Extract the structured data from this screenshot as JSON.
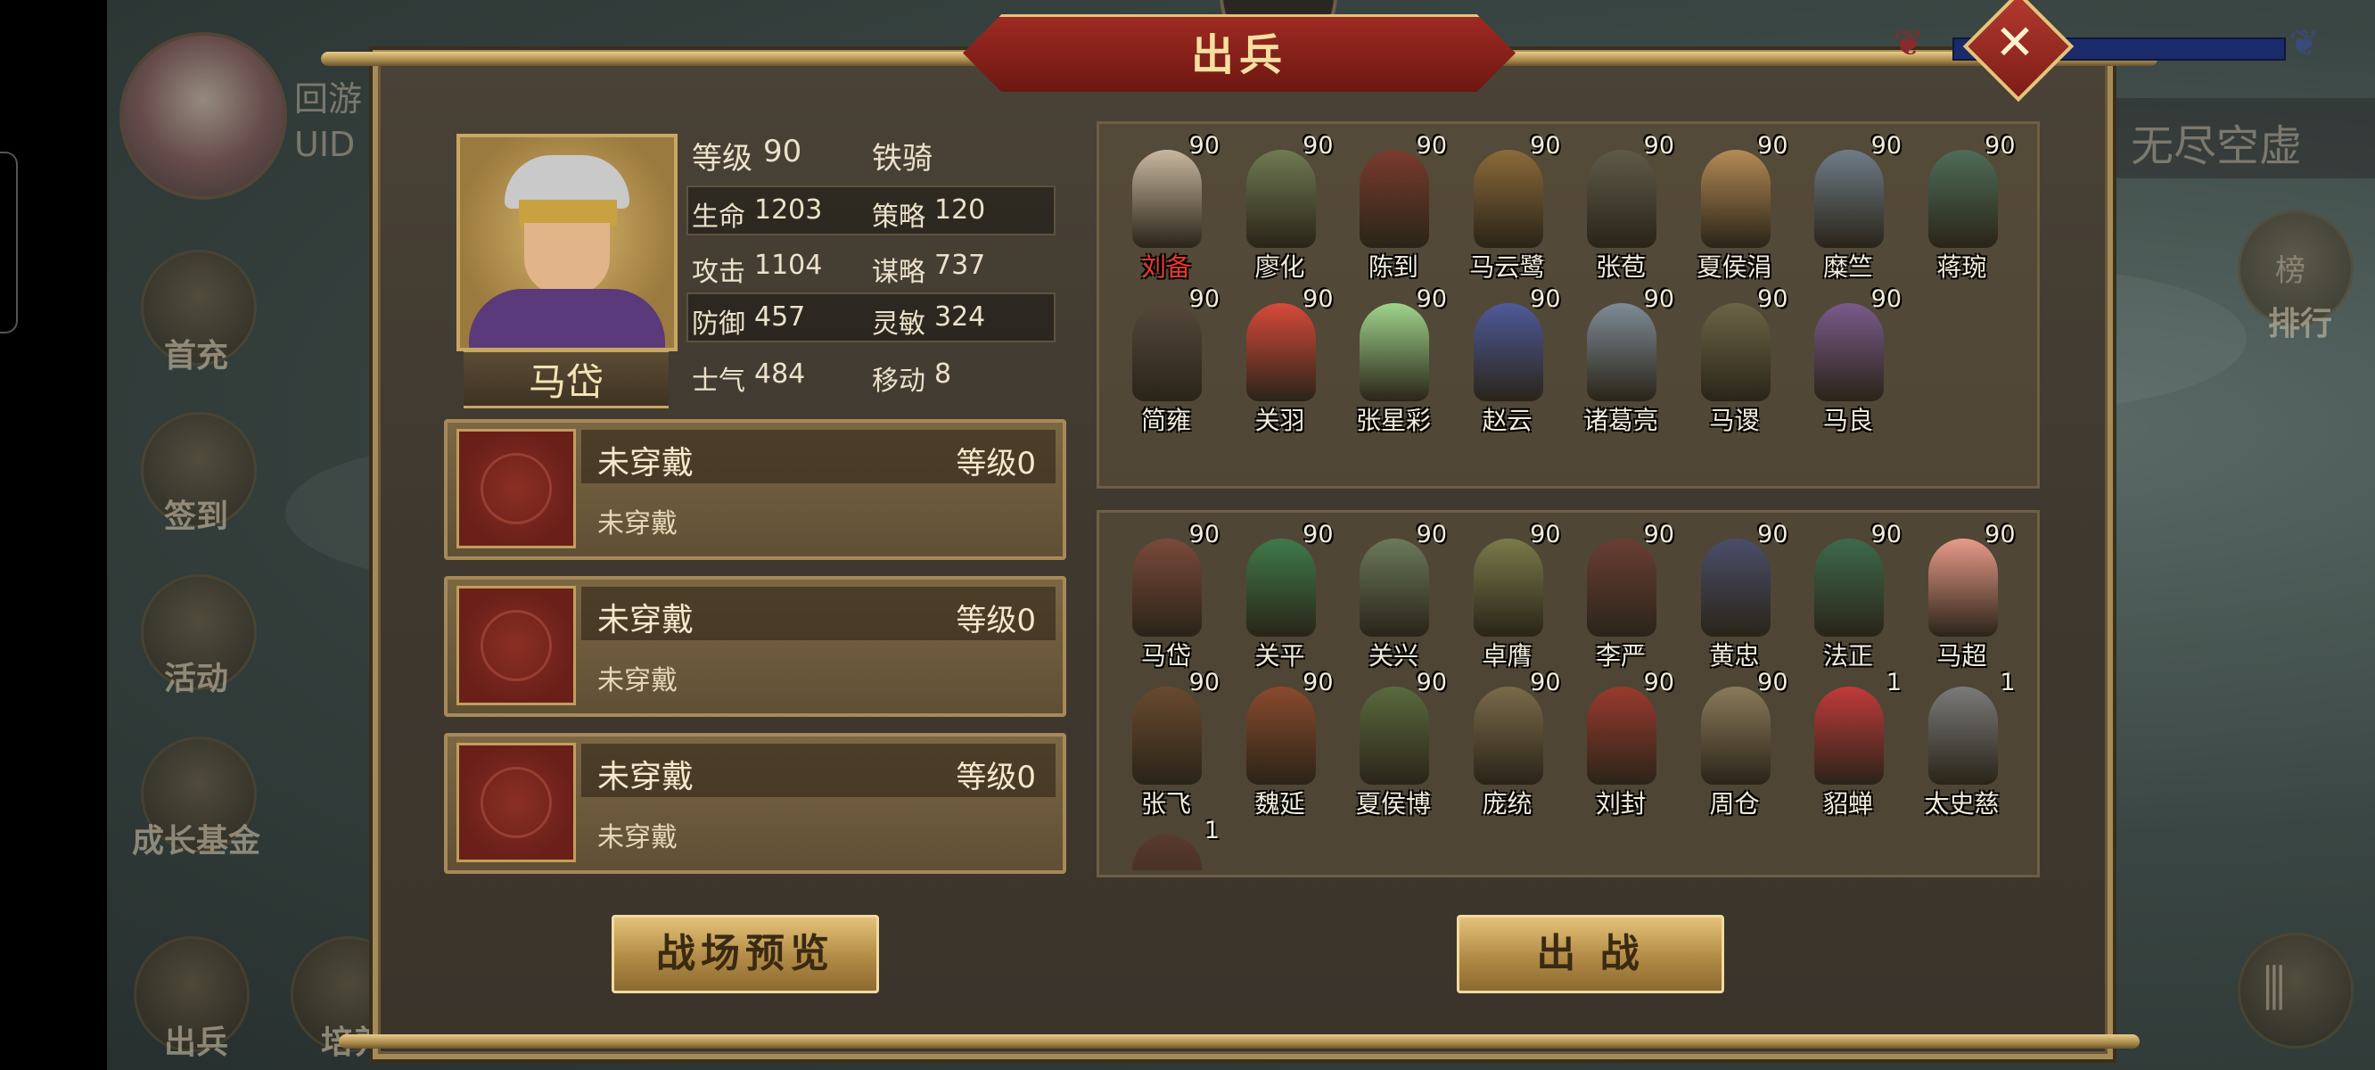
{
  "background": {
    "avatar_text_1": "回游",
    "avatar_text_2": "UID",
    "server_name": "无尽空虚",
    "ranking_label": "排行",
    "ranking_icon_text": "榜",
    "side_menu": [
      "首充",
      "签到",
      "活动",
      "成长基金"
    ],
    "bottom_menu": [
      "出兵",
      "培养"
    ]
  },
  "dialog": {
    "title": "出兵",
    "close_icon": "close-icon"
  },
  "general": {
    "name": "马岱",
    "level_label": "等级",
    "level_value": "90",
    "troop_type": "铁骑",
    "stats": [
      {
        "label": "生命",
        "value": "1203",
        "label2": "策略",
        "value2": "120"
      },
      {
        "label": "攻击",
        "value": "1104",
        "label2": "谋略",
        "value2": "737"
      },
      {
        "label": "防御",
        "value": "457",
        "label2": "灵敏",
        "value2": "324"
      },
      {
        "label": "士气",
        "value": "484",
        "label2": "移动",
        "value2": "8"
      }
    ]
  },
  "equipment": [
    {
      "title": "未穿戴",
      "level_label": "等级",
      "level_value": "0",
      "sub": "未穿戴"
    },
    {
      "title": "未穿戴",
      "level_label": "等级",
      "level_value": "0",
      "sub": "未穿戴"
    },
    {
      "title": "未穿戴",
      "level_label": "等级",
      "level_value": "0",
      "sub": "未穿戴"
    }
  ],
  "selected_heroes": [
    {
      "name": "刘备",
      "level": "90",
      "color": "#c9b8a0",
      "selected": true
    },
    {
      "name": "廖化",
      "level": "90",
      "color": "#6f7a52"
    },
    {
      "name": "陈到",
      "level": "90",
      "color": "#7a3b2e"
    },
    {
      "name": "马云鹭",
      "level": "90",
      "color": "#8c6a3a"
    },
    {
      "name": "张苞",
      "level": "90",
      "color": "#5f5a48"
    },
    {
      "name": "夏侯涓",
      "level": "90",
      "color": "#b48a55"
    },
    {
      "name": "糜竺",
      "level": "90",
      "color": "#6e7c88"
    },
    {
      "name": "蒋琬",
      "level": "90",
      "color": "#4e6d58"
    },
    {
      "name": "简雍",
      "level": "90",
      "color": "#54483a"
    },
    {
      "name": "关羽",
      "level": "90",
      "color": "#d64a3a"
    },
    {
      "name": "张星彩",
      "level": "90",
      "color": "#9fd48c"
    },
    {
      "name": "赵云",
      "level": "90",
      "color": "#4f5a9a"
    },
    {
      "name": "诸葛亮",
      "level": "90",
      "color": "#7d8b96"
    },
    {
      "name": "马谡",
      "level": "90",
      "color": "#6b6446"
    },
    {
      "name": "马良",
      "level": "90",
      "color": "#7a5a8c"
    }
  ],
  "available_heroes": [
    {
      "name": "马岱",
      "level": "90",
      "color": "#7a4a3a"
    },
    {
      "name": "关平",
      "level": "90",
      "color": "#3f7a4a"
    },
    {
      "name": "关兴",
      "level": "90",
      "color": "#6a7a5a"
    },
    {
      "name": "卓膺",
      "level": "90",
      "color": "#7a7a4a"
    },
    {
      "name": "李严",
      "level": "90",
      "color": "#6a3e34"
    },
    {
      "name": "黄忠",
      "level": "90",
      "color": "#4a4e6a"
    },
    {
      "name": "法正",
      "level": "90",
      "color": "#3e6a4a"
    },
    {
      "name": "马超",
      "level": "90",
      "color": "#e89a8a"
    },
    {
      "name": "张飞",
      "level": "90",
      "color": "#6a4a2e"
    },
    {
      "name": "魏延",
      "level": "90",
      "color": "#8a4a2e"
    },
    {
      "name": "夏侯博",
      "level": "90",
      "color": "#5a6a3e"
    },
    {
      "name": "庞统",
      "level": "90",
      "color": "#7a6a4a"
    },
    {
      "name": "刘封",
      "level": "90",
      "color": "#9a3a2e"
    },
    {
      "name": "周仓",
      "level": "90",
      "color": "#8a7a5a"
    },
    {
      "name": "貂蝉",
      "level": "1",
      "color": "#c03a3a"
    },
    {
      "name": "太史慈",
      "level": "1",
      "color": "#7a7a7a"
    },
    {
      "name": "",
      "level": "1",
      "color": "#5a3a2e"
    }
  ],
  "buttons": {
    "preview": "战场预览",
    "battle": "出 战"
  }
}
